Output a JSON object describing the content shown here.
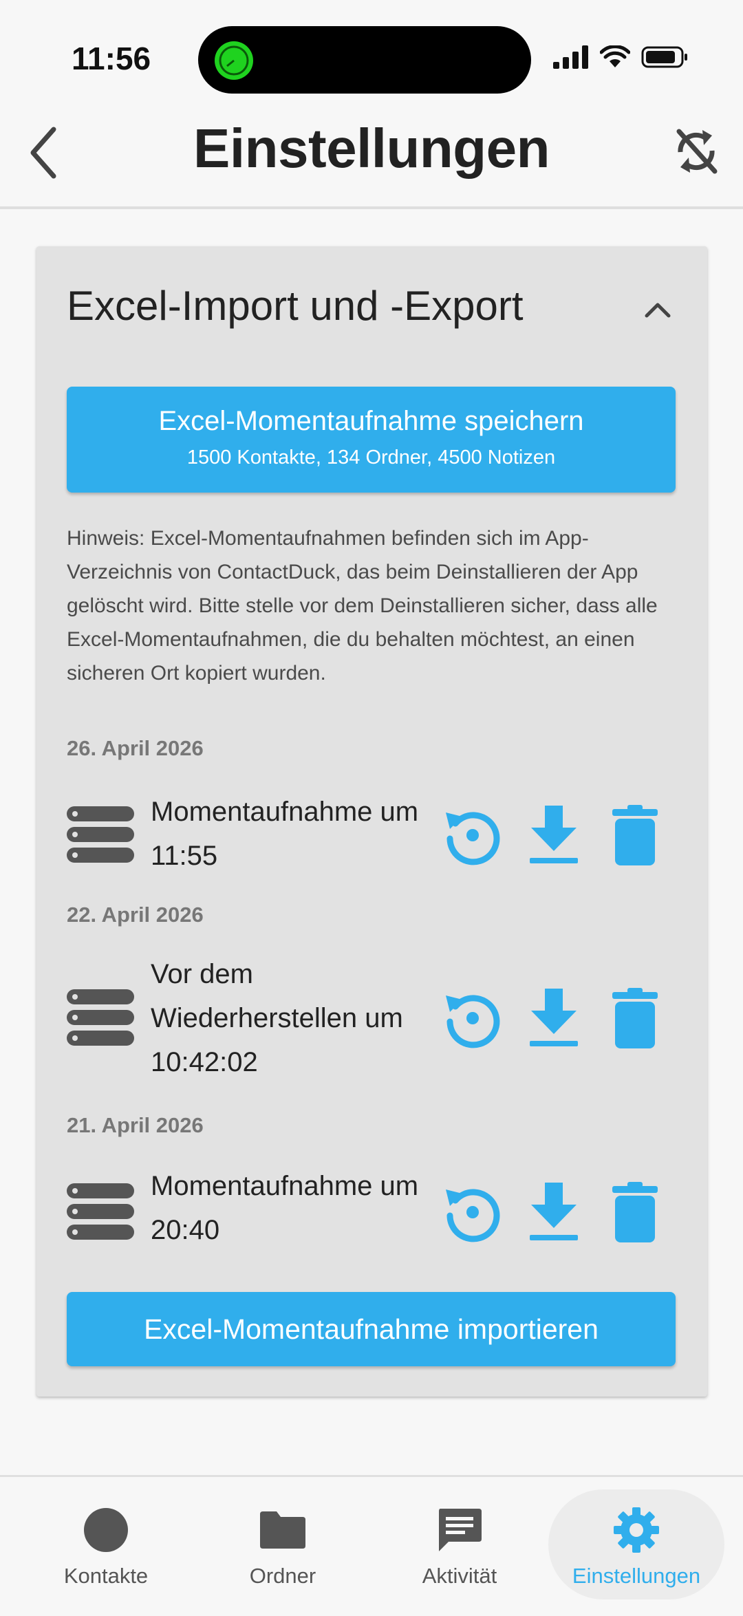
{
  "status": {
    "time": "11:56"
  },
  "header": {
    "title": "Einstellungen"
  },
  "card": {
    "title": "Excel-Import und -Export",
    "save_button": {
      "label": "Excel-Momentaufnahme speichern",
      "sublabel": "1500 Kontakte, 134 Ordner, 4500 Notizen"
    },
    "note": "Hinweis: Excel-Momentaufnahmen befinden sich im App-Verzeichnis von ContactDuck, das beim Deinstallieren der App gelöscht wird. Bitte stelle vor dem Deinstallieren sicher, dass alle Excel-Momentaufnahmen, die du behalten möchtest, an einen sicheren Ort kopiert wurden.",
    "snapshots": [
      {
        "date": "26. April 2026",
        "label": "Momentaufnahme um 11:55"
      },
      {
        "date": "22. April 2026",
        "label": "Vor dem Wiederherstellen um 10:42:02"
      },
      {
        "date": "21. April 2026",
        "label": "Momentaufnahme um 20:40"
      }
    ],
    "import_button": "Excel-Momentaufnahme importieren"
  },
  "nav": {
    "items": [
      {
        "label": "Kontakte",
        "icon": "circle-icon"
      },
      {
        "label": "Ordner",
        "icon": "folder-icon"
      },
      {
        "label": "Aktivität",
        "icon": "chat-icon"
      },
      {
        "label": "Einstellungen",
        "icon": "gear-icon",
        "active": true
      }
    ]
  },
  "colors": {
    "accent": "#30aeec",
    "card": "#e2e2e2",
    "background": "#f7f7f7",
    "icon_dark": "#555555"
  }
}
